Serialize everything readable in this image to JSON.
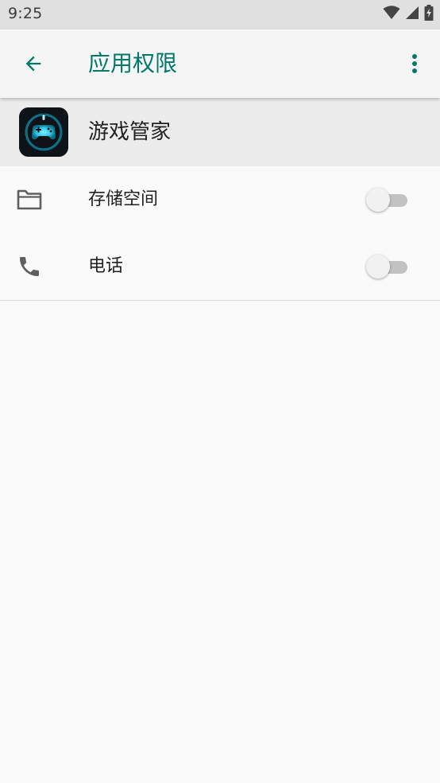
{
  "status_bar": {
    "time": "9:25",
    "icons": [
      "wifi-icon",
      "signal-icon",
      "battery-charging-icon"
    ]
  },
  "app_bar": {
    "title": "应用权限",
    "accent_color": "#00796b",
    "back_icon": "arrow-back-icon",
    "more_icon": "more-vert-icon"
  },
  "app_header": {
    "name": "游戏管家",
    "icon": "gamepad-icon"
  },
  "permissions": [
    {
      "label": "存储空间",
      "icon": "folder-icon",
      "enabled": false
    },
    {
      "label": "电话",
      "icon": "phone-icon",
      "enabled": false
    }
  ]
}
